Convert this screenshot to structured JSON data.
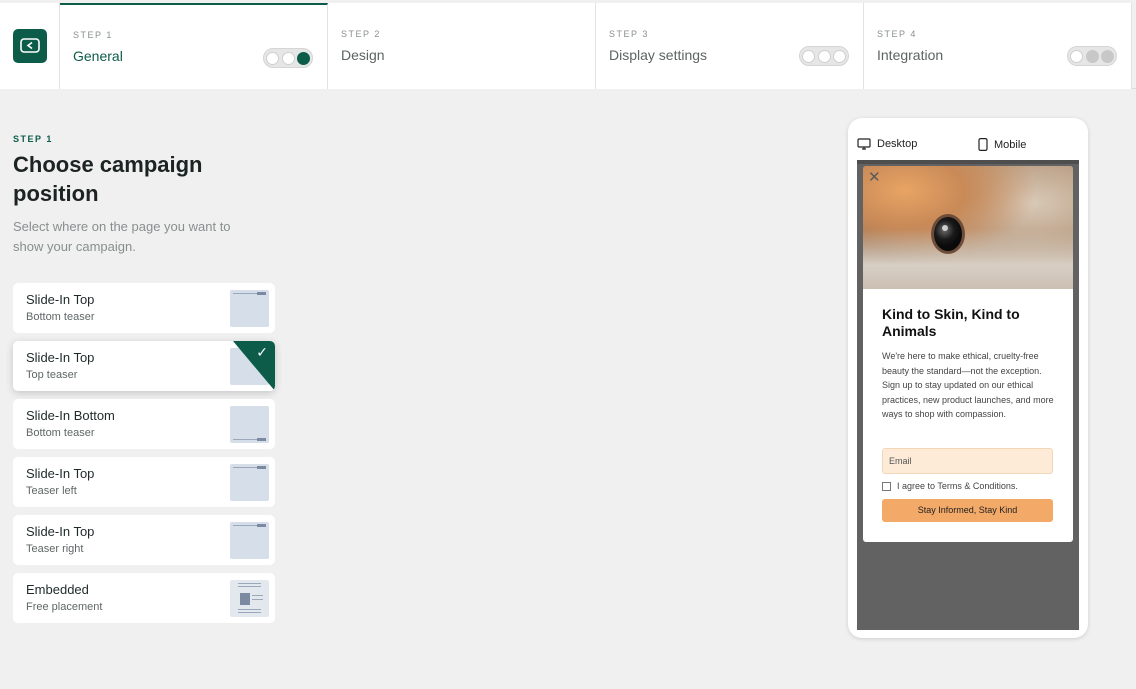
{
  "steps": [
    {
      "num": "STEP 1",
      "label": "General",
      "state": "active"
    },
    {
      "num": "STEP 2",
      "label": "Design",
      "state": "pending"
    },
    {
      "num": "STEP 3",
      "label": "Display settings",
      "state": "pending"
    },
    {
      "num": "STEP 4",
      "label": "Integration",
      "state": "disabled"
    }
  ],
  "main": {
    "eyebrow": "STEP 1",
    "heading": "Choose campaign position",
    "subtitle": "Select where on the page you want to show your campaign."
  },
  "options": [
    {
      "title": "Slide-In Top",
      "subtitle": "Bottom teaser"
    },
    {
      "title": "Slide-In Top",
      "subtitle": "Top teaser",
      "selected": true
    },
    {
      "title": "Slide-In Bottom",
      "subtitle": "Bottom teaser"
    },
    {
      "title": "Slide-In Top",
      "subtitle": "Teaser left"
    },
    {
      "title": "Slide-In Top",
      "subtitle": "Teaser right"
    },
    {
      "title": "Embedded",
      "subtitle": "Free placement"
    }
  ],
  "preview": {
    "tabs": {
      "desktop": "Desktop",
      "mobile": "Mobile"
    },
    "popup": {
      "title": "Kind to Skin, Kind to Animals",
      "description": "We're here to make ethical, cruelty-free beauty the standard—not the exception. Sign up to stay updated on our ethical practices, new product launches, and more ways to shop with compassion.",
      "email_placeholder": "Email",
      "agree_label": "I agree to Terms & Conditions.",
      "cta_label": "Stay Informed, Stay Kind"
    }
  },
  "colors": {
    "brand": "#0d5c4a",
    "cta": "#f3a968",
    "email_bg": "#fdebd8"
  }
}
